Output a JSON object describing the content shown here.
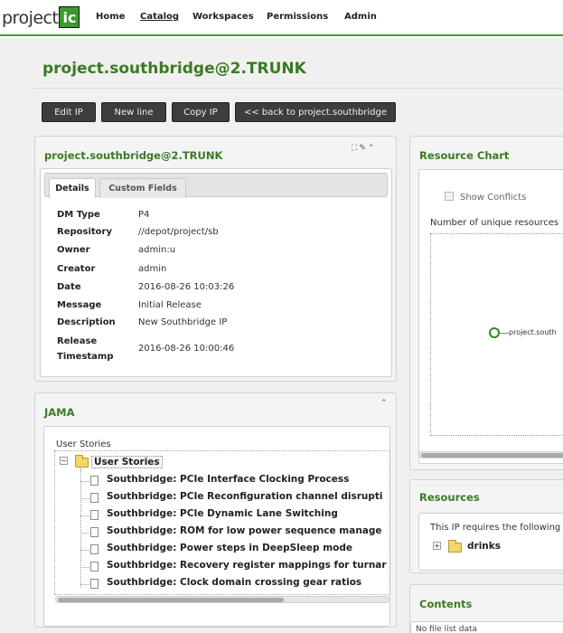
{
  "app": {
    "logo_text": "project",
    "logo_badge": "ic"
  },
  "nav": {
    "items": [
      "Home",
      "Catalog",
      "Workspaces",
      "Permissions",
      "Admin"
    ],
    "active": "Catalog"
  },
  "page": {
    "title": "project.southbridge@2.TRUNK"
  },
  "toolbar": {
    "buttons": [
      "Edit IP",
      "New line",
      "Copy IP",
      "<< back to project.southbridge"
    ]
  },
  "details_panel": {
    "title": "project.southbridge@2.TRUNK",
    "tabs": [
      "Details",
      "Custom Fields"
    ],
    "selected_tab": "Details",
    "properties": [
      {
        "label": "DM Type",
        "value": "P4"
      },
      {
        "label": "Repository",
        "value": "//depot/project/sb"
      },
      {
        "label": "Owner",
        "value": "admin:u"
      },
      {
        "label": "Creator",
        "value": "admin"
      },
      {
        "label": "Date",
        "value": "2016-08-26 10:03:26"
      },
      {
        "label": "Message",
        "value": "Initial Release"
      },
      {
        "label": "Description",
        "value": "New Southbridge IP"
      },
      {
        "label": "Release Timestamp",
        "value": "2016-08-26 10:00:46"
      }
    ],
    "release_label_line1": "Release",
    "release_label_line2": "Timestamp"
  },
  "jama_panel": {
    "title": "JAMA",
    "section_label": "User Stories",
    "root_node": "User Stories",
    "stories": [
      "Southbridge: PCIe Interface Clocking Process",
      "Southbridge: PCIe Reconfiguration channel disrupti",
      "Southbridge: PCIe Dynamic Lane Switching",
      "Southbridge: ROM for low power sequence manage",
      "Southbridge: Power steps in DeepSleep mode",
      "Southbridge: Recovery register mappings for turnar",
      "Southbridge: Clock domain crossing gear ratios"
    ]
  },
  "resource_chart": {
    "title": "Resource Chart",
    "show_conflicts_label": "Show Conflicts",
    "show_conflicts_checked": false,
    "caption": "Number of unique resources",
    "node_label": "project.south"
  },
  "resources_panel": {
    "title": "Resources",
    "text": "This IP requires the following",
    "item": "drinks"
  },
  "contents_panel": {
    "title": "Contents",
    "text": "No file list data"
  }
}
